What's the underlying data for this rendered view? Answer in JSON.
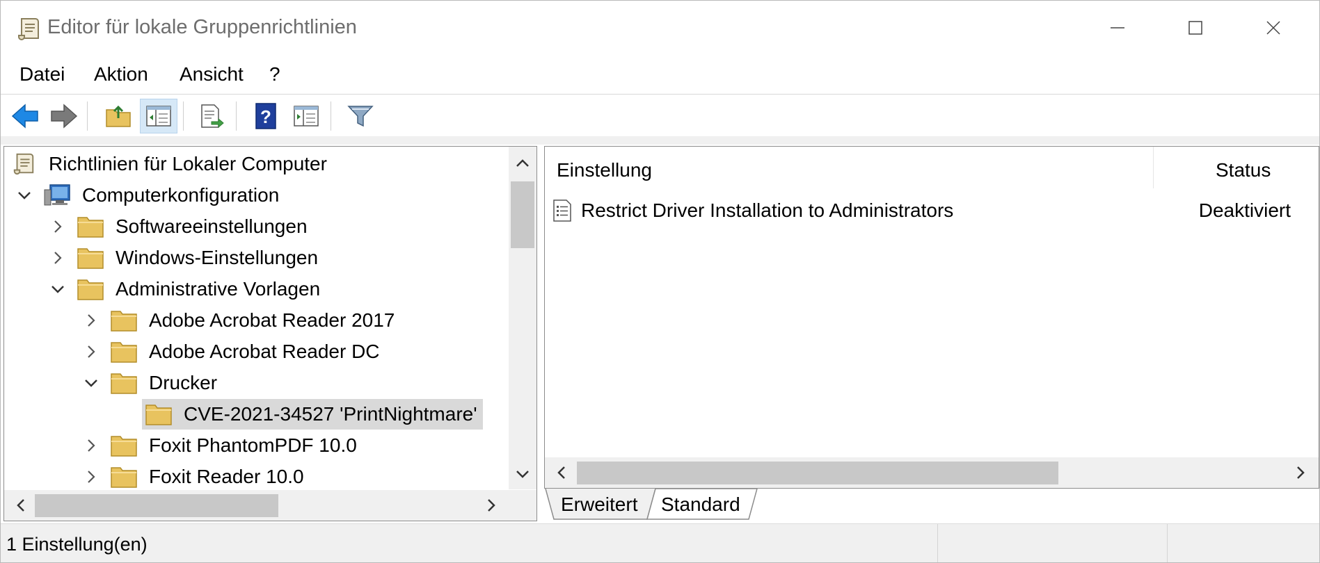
{
  "window": {
    "title": "Editor für lokale Gruppenrichtlinien",
    "icon": "policy-scroll-icon"
  },
  "menu": [
    "Datei",
    "Aktion",
    "Ansicht",
    "?"
  ],
  "toolbar": {
    "buttons": [
      "back-arrow-icon",
      "forward-arrow-icon",
      "up-folder-icon",
      "show-hide-tree-icon",
      "export-list-icon",
      "help-icon",
      "properties-pane-icon",
      "filter-icon"
    ]
  },
  "tree": {
    "root": "Richtlinien für Lokaler Computer",
    "items": [
      {
        "label": "Computerkonfiguration",
        "expanded": true
      },
      {
        "label": "Softwareeinstellungen",
        "expanded": false
      },
      {
        "label": "Windows-Einstellungen",
        "expanded": false
      },
      {
        "label": "Administrative Vorlagen",
        "expanded": true
      },
      {
        "label": "Adobe Acrobat Reader 2017",
        "expanded": false
      },
      {
        "label": "Adobe Acrobat Reader DC",
        "expanded": false
      },
      {
        "label": "Drucker",
        "expanded": true
      },
      {
        "label": "CVE-2021-34527 'PrintNightmare'",
        "selected": true
      },
      {
        "label": "Foxit PhantomPDF 10.0",
        "expanded": false
      },
      {
        "label": "Foxit Reader 10.0",
        "expanded": false
      }
    ]
  },
  "list": {
    "columns": [
      "Einstellung",
      "Status"
    ],
    "rows": [
      {
        "setting": "Restrict Driver Installation to Administrators",
        "status": "Deaktiviert"
      }
    ]
  },
  "tabs": [
    {
      "label": "Erweitert",
      "active": false
    },
    {
      "label": "Standard",
      "active": true
    }
  ],
  "statusbar": {
    "text": "1 Einstellung(en)"
  },
  "colors": {
    "folder": "#e8c35f",
    "selection": "#d9d9d9",
    "back_arrow": "#1e88e5",
    "scroll_track": "#f0f0f0",
    "scroll_thumb": "#c8c8c8"
  }
}
